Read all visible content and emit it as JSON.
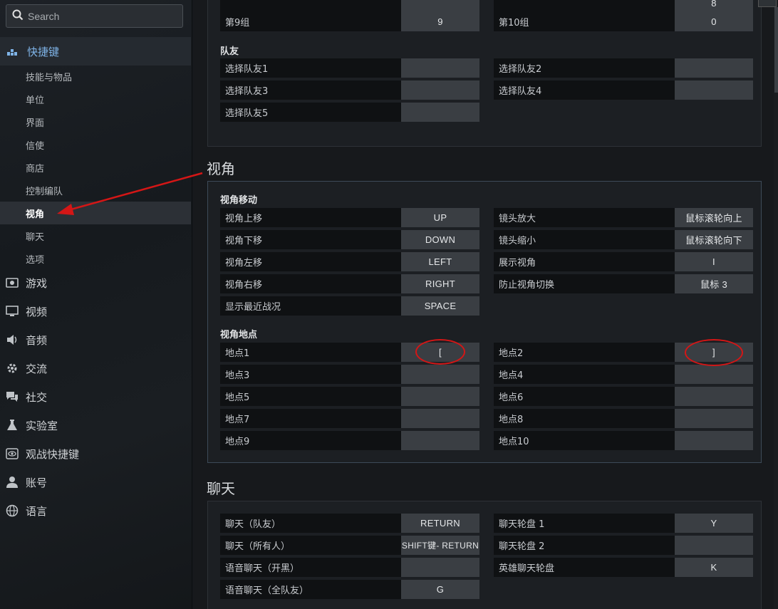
{
  "search": {
    "placeholder": "Search"
  },
  "sidebar": {
    "active_section": "快捷键",
    "sub_items": [
      "技能与物品",
      "单位",
      "界面",
      "信使",
      "商店",
      "控制编队",
      "视角",
      "聊天",
      "选项"
    ],
    "active_sub": "视角",
    "items": [
      {
        "label": "游戏",
        "icon": "game-icon"
      },
      {
        "label": "视频",
        "icon": "monitor-icon"
      },
      {
        "label": "音频",
        "icon": "speaker-icon"
      },
      {
        "label": "交流",
        "icon": "gear-icon"
      },
      {
        "label": "社交",
        "icon": "chat-icon"
      },
      {
        "label": "实验室",
        "icon": "flask-icon"
      },
      {
        "label": "观战快捷键",
        "icon": "eye-icon"
      },
      {
        "label": "账号",
        "icon": "user-icon"
      },
      {
        "label": "语言",
        "icon": "globe-icon"
      }
    ]
  },
  "top_panel": {
    "partial_row": {
      "left_key": "",
      "right_key": "8"
    },
    "row9": {
      "left_label": "第9组",
      "left_key": "9",
      "right_label": "第10组",
      "right_key": "0"
    },
    "teammates_title": "队友",
    "teammates": [
      {
        "label": "选择队友1",
        "key": ""
      },
      {
        "label": "选择队友2",
        "key": ""
      },
      {
        "label": "选择队友3",
        "key": ""
      },
      {
        "label": "选择队友4",
        "key": ""
      },
      {
        "label": "选择队友5",
        "key": ""
      }
    ]
  },
  "camera": {
    "title": "视角",
    "move_title": "视角移动",
    "move_left": [
      {
        "label": "视角上移",
        "key": "UP"
      },
      {
        "label": "视角下移",
        "key": "DOWN"
      },
      {
        "label": "视角左移",
        "key": "LEFT"
      },
      {
        "label": "视角右移",
        "key": "RIGHT"
      },
      {
        "label": "显示最近战况",
        "key": "SPACE"
      }
    ],
    "move_right": [
      {
        "label": "镜头放大",
        "key": "鼠标滚轮向上"
      },
      {
        "label": "镜头缩小",
        "key": "鼠标滚轮向下"
      },
      {
        "label": "展示视角",
        "key": "I"
      },
      {
        "label": "防止视角切换",
        "key": "鼠标 3"
      }
    ],
    "points_title": "视角地点",
    "points_left": [
      {
        "label": "地点1",
        "key": "["
      },
      {
        "label": "地点3",
        "key": ""
      },
      {
        "label": "地点5",
        "key": ""
      },
      {
        "label": "地点7",
        "key": ""
      },
      {
        "label": "地点9",
        "key": ""
      }
    ],
    "points_right": [
      {
        "label": "地点2",
        "key": "]"
      },
      {
        "label": "地点4",
        "key": ""
      },
      {
        "label": "地点6",
        "key": ""
      },
      {
        "label": "地点8",
        "key": ""
      },
      {
        "label": "地点10",
        "key": ""
      }
    ]
  },
  "chat": {
    "title": "聊天",
    "left": [
      {
        "label": "聊天（队友）",
        "key": "RETURN"
      },
      {
        "label": "聊天（所有人）",
        "key": "SHIFT键- RETURN"
      },
      {
        "label": "语音聊天（开黑）",
        "key": ""
      },
      {
        "label": "语音聊天（全队友）",
        "key": "G"
      }
    ],
    "right": [
      {
        "label": "聊天轮盘 1",
        "key": "Y"
      },
      {
        "label": "聊天轮盘 2",
        "key": ""
      },
      {
        "label": "英雄聊天轮盘",
        "key": "K"
      }
    ]
  },
  "colors": {
    "accent": "#7fb4e8",
    "annotation": "#d41616"
  }
}
